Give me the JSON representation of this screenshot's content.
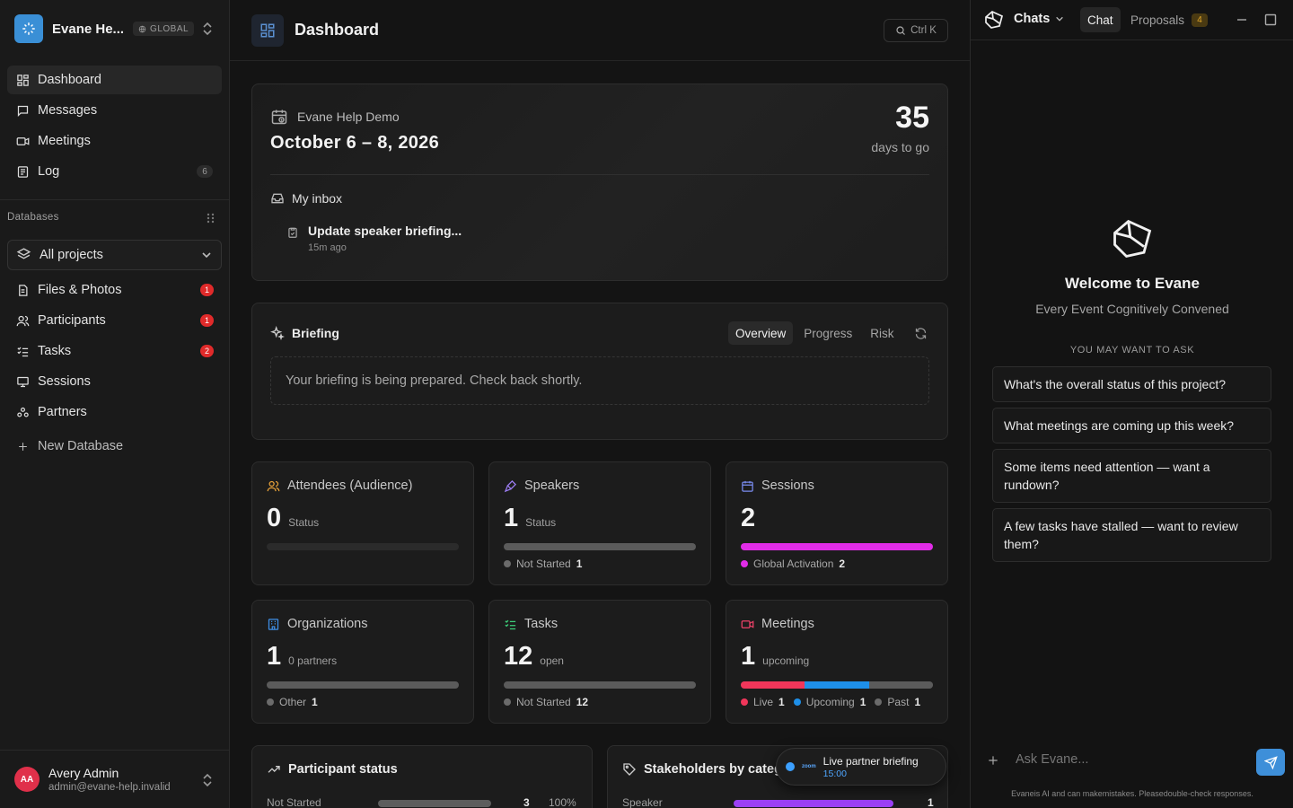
{
  "sidebar": {
    "workspace": {
      "name": "Evane He...",
      "badge": "GLOBAL"
    },
    "nav": [
      {
        "label": "Dashboard",
        "icon": "dashboard-icon"
      },
      {
        "label": "Messages",
        "icon": "message-icon"
      },
      {
        "label": "Meetings",
        "icon": "video-icon"
      },
      {
        "label": "Log",
        "icon": "log-icon",
        "count": "6"
      }
    ],
    "databases_title": "Databases",
    "db_select": "All projects",
    "db_items": [
      {
        "label": "Files & Photos",
        "icon": "file-icon",
        "badge": "1"
      },
      {
        "label": "Participants",
        "icon": "users-icon",
        "badge": "1"
      },
      {
        "label": "Tasks",
        "icon": "tasks-icon",
        "badge": "2"
      },
      {
        "label": "Sessions",
        "icon": "screen-icon"
      },
      {
        "label": "Partners",
        "icon": "partners-icon"
      }
    ],
    "new_database": "New Database",
    "user": {
      "initials": "AA",
      "name": "Avery Admin",
      "email": "admin@evane-help.invalid"
    }
  },
  "main": {
    "title": "Dashboard",
    "search_shortcut": "Ctrl K",
    "event": {
      "name": "Evane Help Demo",
      "dates": "October 6 – 8, 2026",
      "days": "35",
      "days_label": "days to go",
      "inbox_title": "My inbox",
      "inbox_item": {
        "title": "Update speaker briefing...",
        "time": "15m ago"
      }
    },
    "briefing": {
      "title": "Briefing",
      "tabs": [
        "Overview",
        "Progress",
        "Risk"
      ],
      "active_tab": "Overview",
      "message": "Your briefing is being prepared. Check back shortly."
    },
    "stats": [
      {
        "title": "Attendees (Audience)",
        "icon": "users-icon",
        "icon_color": "#e8a23a",
        "value": "0",
        "unit": "Status",
        "segments": [],
        "legend": []
      },
      {
        "title": "Speakers",
        "icon": "mic-icon",
        "icon_color": "#9b7cf0",
        "value": "1",
        "unit": "Status",
        "segments": [
          {
            "color": "#5b5b5b",
            "fraction": 1
          }
        ],
        "legend": [
          {
            "label": "Not Started",
            "count": "1",
            "color": "#6b6b6b"
          }
        ]
      },
      {
        "title": "Sessions",
        "icon": "calendar-icon",
        "icon_color": "#7a8cf0",
        "value": "2",
        "unit": "",
        "segments": [
          {
            "color": "#e12ce8",
            "fraction": 1
          }
        ],
        "legend": [
          {
            "label": "Global Activation",
            "count": "2",
            "color": "#e12ce8"
          }
        ]
      },
      {
        "title": "Organizations",
        "icon": "building-icon",
        "icon_color": "#3e8fe6",
        "value": "1",
        "unit": "0 partners",
        "segments": [
          {
            "color": "#5b5b5b",
            "fraction": 1
          }
        ],
        "legend": [
          {
            "label": "Other",
            "count": "1",
            "color": "#6b6b6b"
          }
        ]
      },
      {
        "title": "Tasks",
        "icon": "tasks-icon",
        "icon_color": "#3ecf7a",
        "value": "12",
        "unit": "open",
        "segments": [
          {
            "color": "#5b5b5b",
            "fraction": 1
          }
        ],
        "legend": [
          {
            "label": "Not Started",
            "count": "12",
            "color": "#6b6b6b"
          }
        ]
      },
      {
        "title": "Meetings",
        "icon": "video-icon",
        "icon_color": "#f0436a",
        "value": "1",
        "unit": "upcoming",
        "segments": [
          {
            "color": "#f0365a",
            "fraction": 0.333
          },
          {
            "color": "#1e8fe8",
            "fraction": 0.334
          },
          {
            "color": "#5b5b5b",
            "fraction": 0.333
          }
        ],
        "legend": [
          {
            "label": "Live",
            "count": "1",
            "color": "#f0365a"
          },
          {
            "label": "Upcoming",
            "count": "1",
            "color": "#1e8fe8"
          },
          {
            "label": "Past",
            "count": "1",
            "color": "#6b6b6b"
          }
        ]
      }
    ],
    "participant_status": {
      "title": "Participant status",
      "row_label": "Not Started",
      "row_count": "3",
      "row_pct": "100%",
      "bar_fill": 1
    },
    "stakeholders": {
      "title": "Stakeholders by categ",
      "row_label": "Speaker",
      "row_count": "1",
      "bar_fill": 1
    },
    "toast": {
      "title": "Live partner briefing",
      "time": "15:00",
      "brand": "zoom"
    }
  },
  "chat": {
    "header": "Chats",
    "tabs": [
      "Chat",
      "Proposals"
    ],
    "proposals_count": "4",
    "welcome_title": "Welcome to Evane",
    "welcome_sub": "Every Event Cognitively Convened",
    "ask_title": "YOU MAY WANT TO ASK",
    "suggestions": [
      "What's the overall status of this project?",
      "What meetings are coming up this week?",
      "Some items need attention — want a rundown?",
      "A few tasks have stalled — want to review them?"
    ],
    "input_placeholder": "Ask Evane...",
    "footer": "Evaneis AI and can makemistakes. Pleasedouble-check responses."
  },
  "colors": {
    "accent": "#3a8fd6",
    "danger": "#e02a2a",
    "sessions": "#e12ce8",
    "stakeholder_bar": "#9b40f5"
  }
}
